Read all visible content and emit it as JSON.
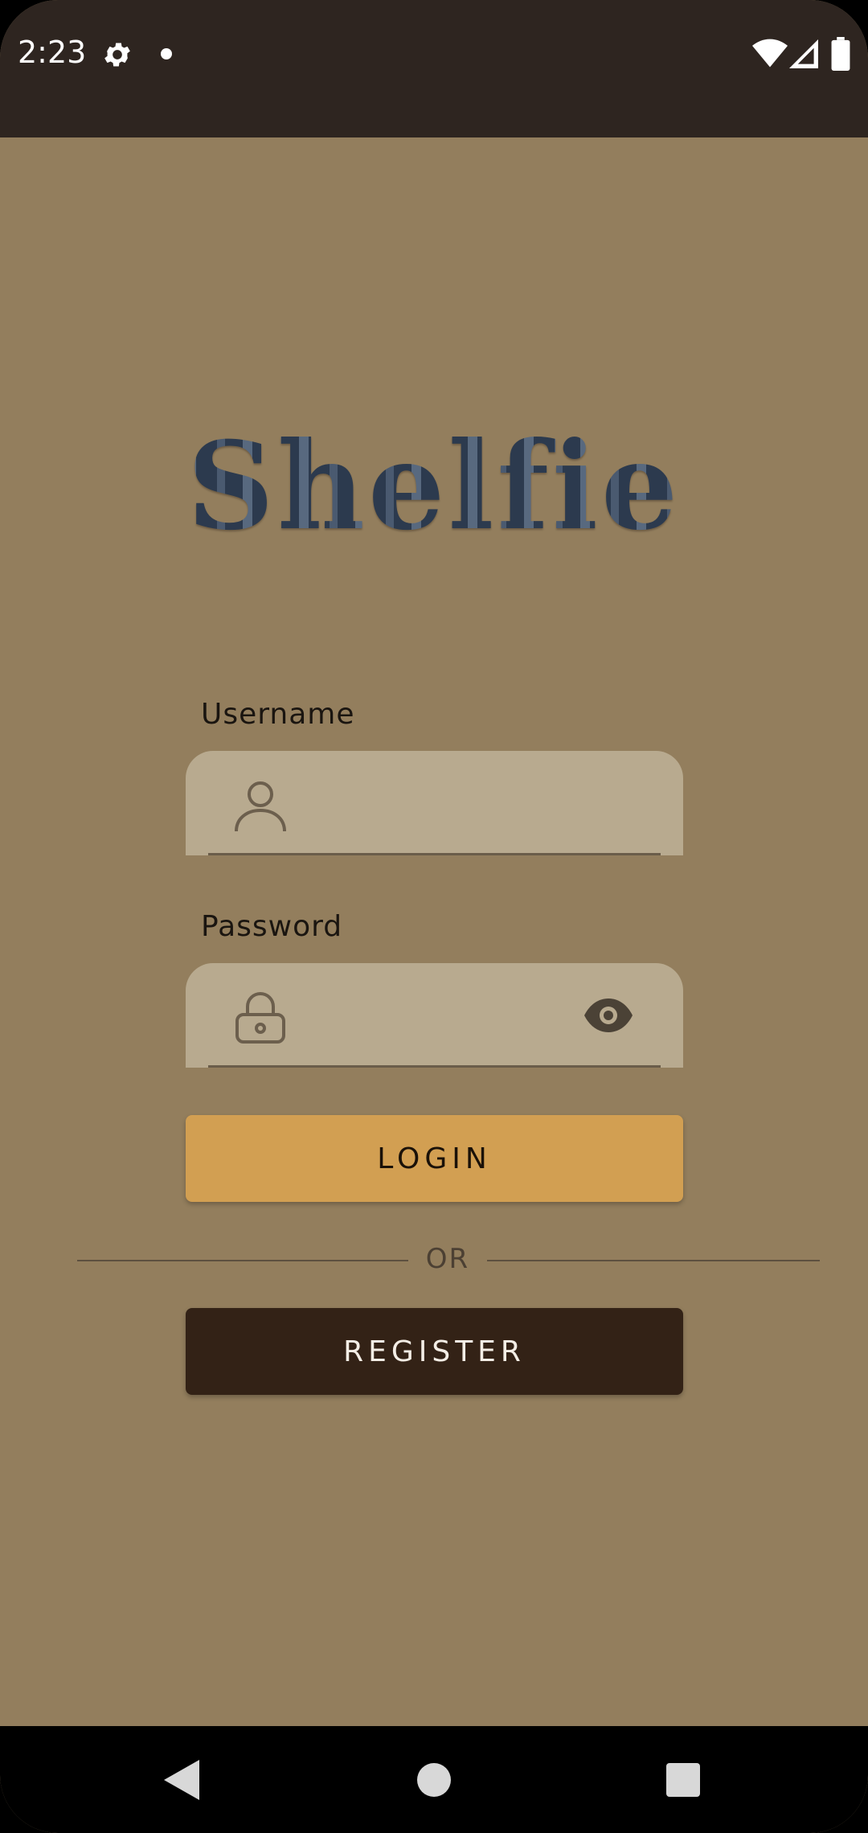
{
  "status_bar": {
    "time": "2:23",
    "icons": [
      "gear-icon",
      "notification-dot-icon",
      "wifi-icon",
      "cell-signal-icon",
      "battery-icon"
    ]
  },
  "app": {
    "logo_text": "Shelfie"
  },
  "form": {
    "username_label": "Username",
    "username_value": "",
    "password_label": "Password",
    "password_value": "",
    "login_label": "LOGIN",
    "divider_text": "OR",
    "register_label": "REGISTER"
  },
  "nav_bar": {
    "icons": [
      "back-icon",
      "home-icon",
      "recents-icon"
    ]
  },
  "colors": {
    "background": "#937e5d",
    "status_bar": "#2e2520",
    "input_fill": "#b8aa8f",
    "login_button": "#d29f52",
    "register_button": "#332216"
  }
}
